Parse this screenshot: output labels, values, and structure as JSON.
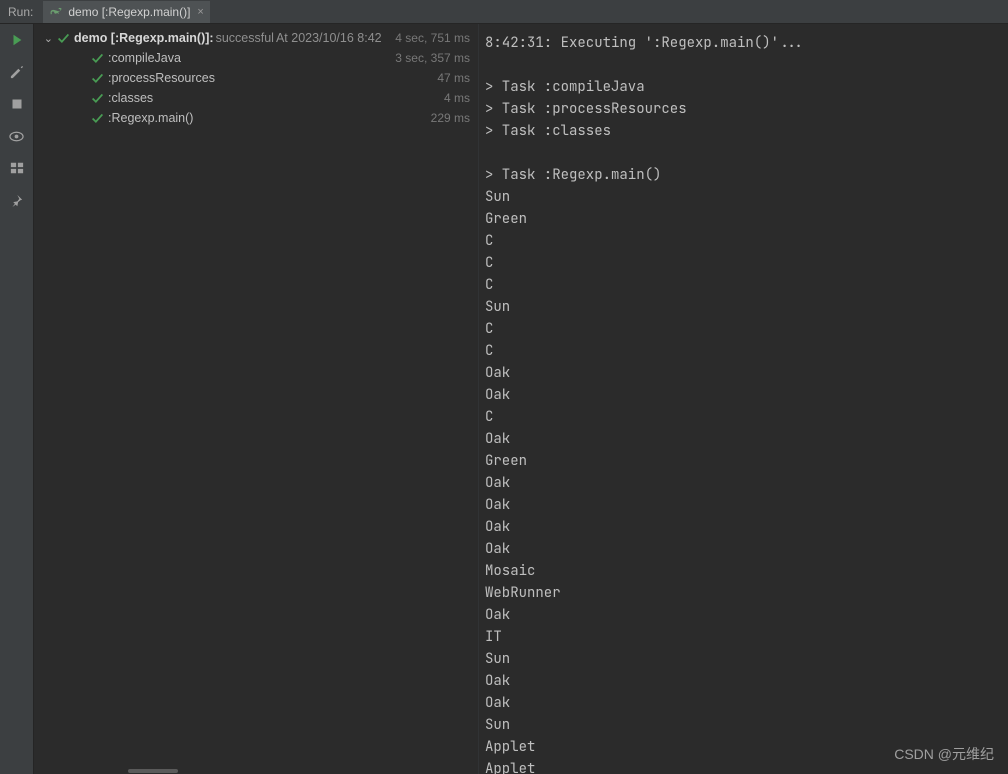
{
  "topbar": {
    "run_label": "Run:",
    "tab_label": "demo [:Regexp.main()]",
    "close_x": "×"
  },
  "tree": {
    "root": {
      "label": "demo [:Regexp.main()]:",
      "status": "successful",
      "at": "At 2023/10/16 8:42",
      "dur": "4 sec, 751 ms"
    },
    "children": [
      {
        "label": ":compileJava",
        "dur": "3 sec, 357 ms"
      },
      {
        "label": ":processResources",
        "dur": "47 ms"
      },
      {
        "label": ":classes",
        "dur": "4 ms"
      },
      {
        "label": ":Regexp.main()",
        "dur": "229 ms"
      }
    ]
  },
  "console_lines": [
    "8:42:31: Executing ':Regexp.main()'...",
    "",
    "> Task :compileJava",
    "> Task :processResources",
    "> Task :classes",
    "",
    "> Task :Regexp.main()",
    "Sun",
    "Green",
    "C",
    "C",
    "C",
    "Sun",
    "C",
    "C",
    "Oak",
    "Oak",
    "C",
    "Oak",
    "Green",
    "Oak",
    "Oak",
    "Oak",
    "Oak",
    "Mosaic",
    "WebRunner",
    "Oak",
    "IT",
    "Sun",
    "Oak",
    "Oak",
    "Sun",
    "Applet",
    "Applet"
  ],
  "watermark": "CSDN @元维纪"
}
